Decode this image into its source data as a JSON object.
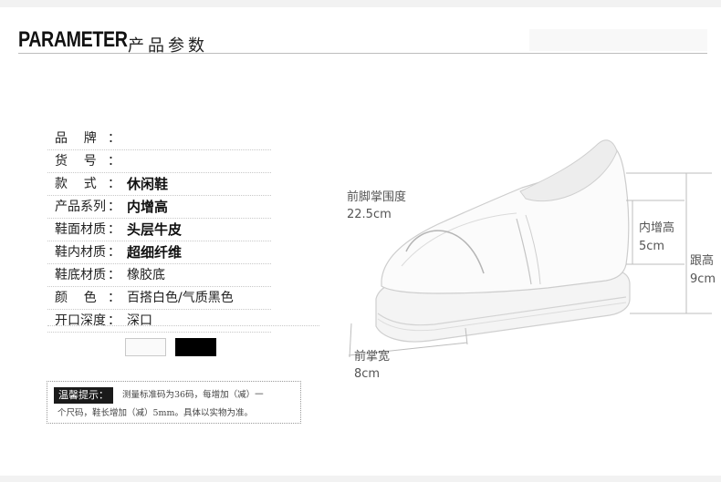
{
  "header": {
    "title": "PARAMETER",
    "subtitle": "产品参数"
  },
  "params": [
    {
      "label": "品    牌",
      "value": "",
      "bold": false
    },
    {
      "label": "货    号",
      "value": "",
      "bold": false
    },
    {
      "label": "款    式",
      "value": "休闲鞋",
      "bold": true
    },
    {
      "label": "产品系列",
      "value": "内增高",
      "bold": true
    },
    {
      "label": "鞋面材质",
      "value": "头层牛皮",
      "bold": true
    },
    {
      "label": "鞋内材质",
      "value": "超细纤维",
      "bold": true
    },
    {
      "label": "鞋底材质",
      "value": "橡胶底",
      "bold": false
    },
    {
      "label": "颜    色",
      "value": "百搭白色/气质黑色",
      "bold": false
    },
    {
      "label": "开口深度",
      "value": "深口",
      "bold": false
    }
  ],
  "param_colon": "：",
  "color_swatches": [
    "#fafafa",
    "#000000"
  ],
  "tip": {
    "label": "温馨提示：",
    "line1": "测量标准码为36码，每增加（减）一",
    "line2": "个尺码，鞋长增加（减）5mm。具体以实物为准。"
  },
  "dimensions": {
    "front_girth_label": "前脚掌围度",
    "front_girth_value": "22.5cm",
    "inner_height_label": "内增高",
    "inner_height_value": "5cm",
    "heel_height_label": "跟高",
    "heel_height_value": "9cm",
    "front_width_label": "前掌宽",
    "front_width_value": "8cm"
  }
}
